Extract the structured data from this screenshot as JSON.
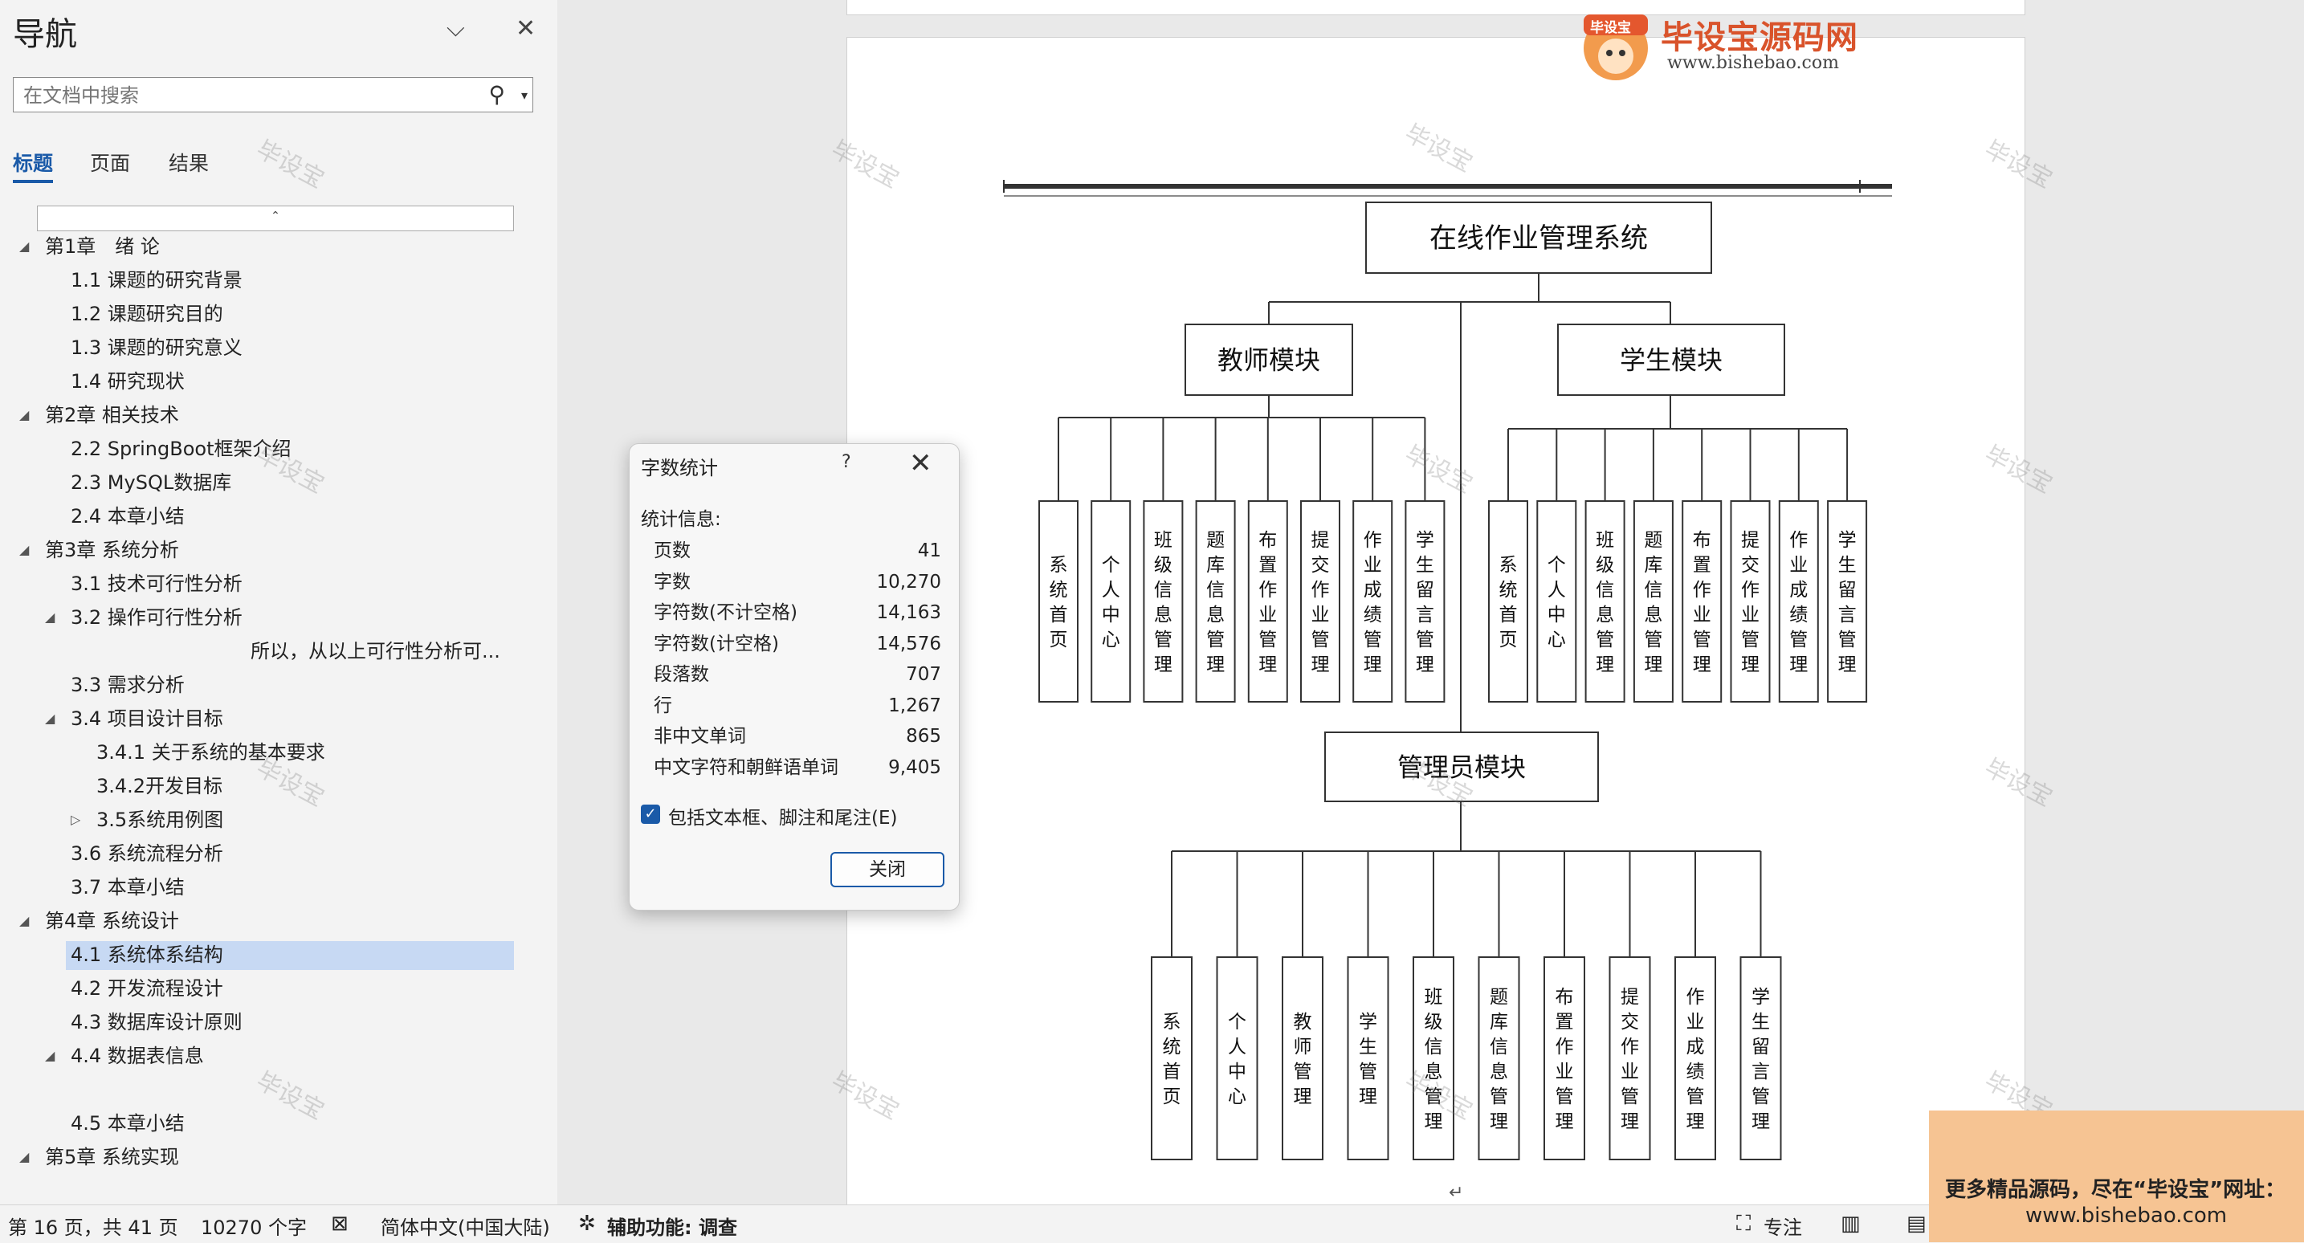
{
  "nav": {
    "title": "导航",
    "search_placeholder": "在文档中搜索",
    "tabs": [
      "标题",
      "页面",
      "结果"
    ],
    "items": [
      {
        "label": "第1章　绪 论",
        "level": 0,
        "expanded": true
      },
      {
        "label": "1.1 课题的研究背景",
        "level": 1
      },
      {
        "label": "1.2 课题研究目的",
        "level": 1
      },
      {
        "label": "1.3 课题的研究意义",
        "level": 1
      },
      {
        "label": "1.4 研究现状",
        "level": 1
      },
      {
        "label": "第2章  相关技术",
        "level": 0,
        "expanded": true
      },
      {
        "label": "2.2  SpringBoot框架介绍",
        "level": 1
      },
      {
        "label": "2.3 MySQL数据库",
        "level": 1
      },
      {
        "label": "2.4 本章小结",
        "level": 1
      },
      {
        "label": "第3章  系统分析",
        "level": 0,
        "expanded": true
      },
      {
        "label": "3.1 技术可行性分析",
        "level": 1
      },
      {
        "label": "3.2  操作可行性分析",
        "level": 1,
        "expanded": true
      },
      {
        "label": "所以，从以上可行性分析可...",
        "level": 3
      },
      {
        "label": "3.3 需求分析",
        "level": 1
      },
      {
        "label": "3.4 项目设计目标",
        "level": 1,
        "expanded": true
      },
      {
        "label": "3.4.1 关于系统的基本要求",
        "level": 2
      },
      {
        "label": "3.4.2开发目标",
        "level": 2
      },
      {
        "label": "3.5系统用例图",
        "level": 2,
        "collapsed": true
      },
      {
        "label": "3.6 系统流程分析",
        "level": 1
      },
      {
        "label": "3.7  本章小结",
        "level": 1
      },
      {
        "label": "第4章  系统设计",
        "level": 0,
        "expanded": true
      },
      {
        "label": "4.1 系统体系结构",
        "level": 1,
        "selected": true
      },
      {
        "label": "4.2  开发流程设计",
        "level": 1
      },
      {
        "label": "4.3  数据库设计原则",
        "level": 1
      },
      {
        "label": "4.4  数据表信息",
        "level": 1,
        "expanded": true
      },
      {
        "label": "",
        "level": 1
      },
      {
        "label": "4.5  本章小结",
        "level": 1
      },
      {
        "label": "第5章  系统实现",
        "level": 0,
        "expanded": true
      }
    ]
  },
  "logo": {
    "name": "毕设宝源码网",
    "url": "www.bishebao.com",
    "badge": "毕设宝"
  },
  "watermark": "毕设宝",
  "diagram": {
    "root": "在线作业管理系统",
    "teacher": {
      "title": "教师模块",
      "children": [
        "系统首页",
        "个人中心",
        "班级信息管理",
        "题库信息管理",
        "布置作业管理",
        "提交作业管理",
        "作业成绩管理",
        "学生留言管理"
      ]
    },
    "student": {
      "title": "学生模块",
      "children": [
        "系统首页",
        "个人中心",
        "班级信息管理",
        "题库信息管理",
        "布置作业管理",
        "提交作业管理",
        "作业成绩管理",
        "学生留言管理"
      ]
    },
    "admin": {
      "title": "管理员模块",
      "children": [
        "系统首页",
        "个人中心",
        "教师管理",
        "学生管理",
        "班级信息管理",
        "题库信息管理",
        "布置作业管理",
        "提交作业管理",
        "作业成绩管理",
        "学生留言管理"
      ]
    }
  },
  "paragraph_mark": "↵",
  "dialog": {
    "title": "字数统计",
    "help": "?",
    "section": "统计信息:",
    "stats": [
      {
        "label": "页数",
        "value": "41"
      },
      {
        "label": "字数",
        "value": "10,270"
      },
      {
        "label": "字符数(不计空格)",
        "value": "14,163"
      },
      {
        "label": "字符数(计空格)",
        "value": "14,576"
      },
      {
        "label": "段落数",
        "value": "707"
      },
      {
        "label": "行",
        "value": "1,267"
      },
      {
        "label": "非中文单词",
        "value": "865"
      },
      {
        "label": "中文字符和朝鲜语单词",
        "value": "9,405"
      }
    ],
    "checkbox_label": "包括文本框、脚注和尾注(E)",
    "checkbox_checked": true,
    "close_label": "关闭"
  },
  "status": {
    "page": "第 16 页，共 41 页",
    "words": "10270 个字",
    "language": "简体中文(中国大陆)",
    "accessibility": "辅助功能: 调查",
    "focus": "专注"
  },
  "promo": {
    "line1": "更多精品源码，尽在“毕设宝”网址：",
    "line2": "www.bishebao.com"
  },
  "colors": {
    "accent": "#1a5aa8",
    "selection": "#c7d9f3",
    "promo_bg": "#f6c493",
    "logo_red": "#d9532b"
  }
}
